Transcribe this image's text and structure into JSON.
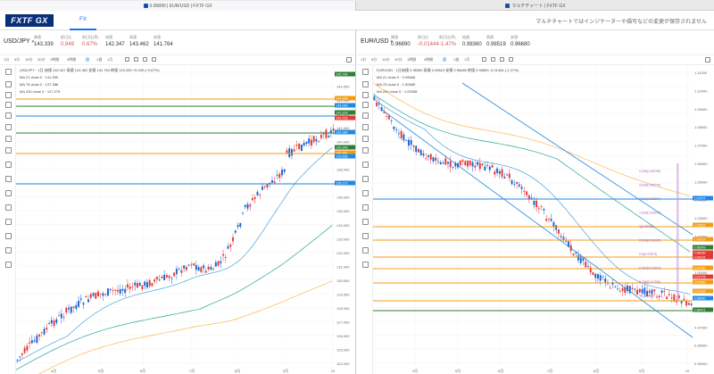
{
  "browser_tabs": [
    {
      "title": "0.96890 | EUR/USD | FXTF GX"
    },
    {
      "title": "マルチチャート | FXTF GX"
    }
  ],
  "app": {
    "logo": "FXTF GX",
    "nav_fx": "FX",
    "notice": "マルチチャートではインジケーターや描写などの変更が保存されません"
  },
  "timeframes": [
    "1分",
    "5分",
    "15分",
    "30分",
    "1時間",
    "4時間",
    "日",
    "1週",
    "1月"
  ],
  "panels": [
    {
      "pair": "USD/JPY",
      "quote_labels": [
        "買値",
        "前日比",
        "前日比(率)",
        "始値",
        "高値",
        "安値"
      ],
      "quote_values": [
        "143.339",
        "0.949",
        "0.67%",
        "142.347",
        "143.462",
        "141.764"
      ],
      "legend_title": "USD/JPY · 1日",
      "ohlc": "始値 142.347 高値 143.462 安値 141.764 終値 143.339 +0.949 (+0.67%)",
      "ma_lines": [
        "MA 21 close 0 · 141.999",
        "MA 75 close 0 · 137.386",
        "MA 200 close 0 · 127.275"
      ],
      "y_ticks": [
        "145.784",
        "144.000",
        "143.000",
        "142.000",
        "141.000",
        "140.000",
        "139.000",
        "138.000",
        "137.000",
        "136.000",
        "135.000",
        "134.000",
        "133.000",
        "132.000",
        "131.000",
        "130.000",
        "129.000",
        "128.000",
        "127.000",
        "126.000",
        "125.000",
        "124.000"
      ],
      "x_ticks": [
        "4月",
        "5月",
        "6月",
        "7月",
        "8月",
        "9月",
        "10"
      ],
      "price_tags": [
        "145.784",
        "144.868",
        "144.063",
        "143.339",
        "142.763",
        "141.080",
        "140.348",
        "140.281",
        "139.656",
        "136.172"
      ]
    },
    {
      "pair": "EUR/USD",
      "quote_labels": [
        "買値",
        "前日比",
        "前日比(率)",
        "始値",
        "高値",
        "安値"
      ],
      "quote_values": [
        "0.96890",
        "-0.01444",
        "-1.47%",
        "0.98360",
        "0.98519",
        "0.96680"
      ],
      "legend_title": "EUR/USD · 1日",
      "ohlc": "始値 0.98360 高値 0.98519 安値 0.96680 終値 0.96890 -0.01444 (-1.47%)",
      "ma_lines": [
        "MA 21 close 0 · 0.99666",
        "MA 75 close 0 · 1.00589",
        "MA 200 close 0 · 1.05338"
      ],
      "y_ticks": [
        "1.11000",
        "1.10000",
        "1.09000",
        "1.08000",
        "1.07000",
        "1.06000",
        "1.05000",
        "1.04000",
        "1.03000",
        "1.02000",
        "1.01000",
        "1.00000",
        "0.99000",
        "0.98000",
        "0.97000",
        "0.96000",
        "0.95000"
      ],
      "x_ticks": [
        "4月",
        "5月",
        "6月",
        "7月",
        "8月",
        "9月",
        "10"
      ],
      "fib_labels": [
        "4.236(1.06795)",
        "3.618(1.05279)",
        "2.618(1.02907)",
        "1.618(1.00534)",
        "1(0.99068)",
        "0.618(0.98163)",
        "0.5(0.97873)",
        "0.382(0.97602)",
        "0.236(0.97255)",
        "0(0.96690)"
      ],
      "price_tags": [
        "1.03707",
        "1.00919",
        "1.00137",
        "0.98349",
        "0.98180",
        "0.98116",
        "0.97990",
        "0.97775",
        "0.97550",
        "0.97002",
        "0.96890",
        "0.96471"
      ]
    }
  ],
  "colors": {
    "up": "#e53935",
    "down": "#1e62d0",
    "ma21": "#4aa3df",
    "ma75": "#26a69a",
    "ma200": "#ffb74d",
    "level_orange": "#f39c12",
    "level_blue": "#1e88e5",
    "level_green": "#2e7d32",
    "fib": "#c9a0dc"
  },
  "icons": [
    "crosshair-icon",
    "trendline-icon",
    "ray-icon",
    "pencil-icon",
    "text-icon",
    "fork-icon",
    "measure-icon",
    "zoom-icon",
    "magnet-icon",
    "lock-icon",
    "eye-icon",
    "trash-icon"
  ]
}
